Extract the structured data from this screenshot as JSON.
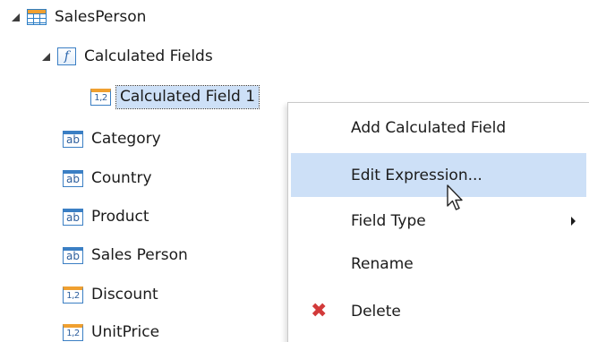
{
  "tree": {
    "root": {
      "label": "SalesPerson",
      "icon": "table-icon"
    },
    "calculated_group": {
      "label": "Calculated Fields",
      "icon": "function-icon"
    },
    "calculated_field": {
      "label": "Calculated Field 1",
      "icon": "numeric-field-icon",
      "icon_text": "1,2"
    },
    "fields": [
      {
        "label": "Category",
        "icon": "string-field-icon",
        "icon_text": "ab"
      },
      {
        "label": "Country",
        "icon": "string-field-icon",
        "icon_text": "ab"
      },
      {
        "label": "Product",
        "icon": "string-field-icon",
        "icon_text": "ab"
      },
      {
        "label": "Sales Person",
        "icon": "string-field-icon",
        "icon_text": "ab"
      },
      {
        "label": "Discount",
        "icon": "numeric-field-icon",
        "icon_text": "1,2"
      },
      {
        "label": "UnitPrice",
        "icon": "numeric-field-icon",
        "icon_text": "1,2"
      }
    ],
    "function_icon_text": "f"
  },
  "context_menu": {
    "items": [
      {
        "label": "Add Calculated Field"
      },
      {
        "label": "Edit Expression..."
      },
      {
        "label": "Field Type"
      },
      {
        "label": "Rename"
      },
      {
        "label": "Delete",
        "icon": "delete-icon"
      }
    ]
  },
  "colors": {
    "selection": "#cde0f7",
    "icon_blue": "#3b7fc4",
    "icon_orange": "#f0a030",
    "delete_red": "#d23a3a"
  }
}
